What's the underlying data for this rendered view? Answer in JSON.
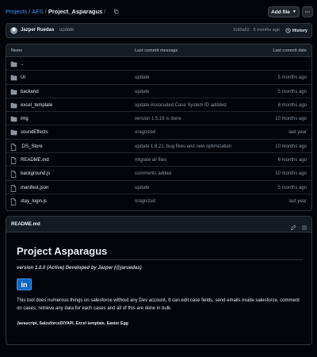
{
  "breadcrumb": {
    "parts": [
      "Projects",
      "AFS",
      "Project_Asparagus"
    ],
    "separator": "/"
  },
  "toolbar": {
    "add_file_label": "Add file",
    "more_label": "···"
  },
  "commit": {
    "author": "Jazper Ruedas",
    "message": "update",
    "meta": "1160a52 · 5 months ago",
    "history_label": "History"
  },
  "files": {
    "headers": {
      "name": "Name",
      "message": "Last commit message",
      "date": "Last commit date"
    },
    "rows": [
      {
        "name": "..",
        "message": "",
        "date": "",
        "icon": "folder-icon"
      },
      {
        "name": "UI",
        "message": "update",
        "date": "5 months ago",
        "icon": "folder-icon"
      },
      {
        "name": "backend",
        "message": "update",
        "date": "5 months ago",
        "icon": "folder-icon"
      },
      {
        "name": "excel_template",
        "message": "update Associated Case System ID addded",
        "date": "8 months ago",
        "icon": "folder-icon"
      },
      {
        "name": "img",
        "message": "version 1.5.16 is done",
        "date": "10 months ago",
        "icon": "folder-icon"
      },
      {
        "name": "soundEffects",
        "message": "oragnized",
        "date": "last year",
        "icon": "folder-icon"
      },
      {
        "name": ".DS_Store",
        "message": "update 1.8.21, bug fixes and new optimization",
        "date": "10 months ago",
        "icon": "file-icon"
      },
      {
        "name": "README.md",
        "message": "migrate all files",
        "date": "6 months ago",
        "icon": "file-icon"
      },
      {
        "name": "background.js",
        "message": "comments added",
        "date": "10 months ago",
        "icon": "file-icon"
      },
      {
        "name": "manifest.json",
        "message": "update",
        "date": "5 months ago",
        "icon": "file-icon"
      },
      {
        "name": "stay_login.js",
        "message": "oragnized",
        "date": "last year",
        "icon": "file-icon"
      }
    ]
  },
  "readme": {
    "tab_label": "README.md",
    "title": "Project Asparagus",
    "version_line": "version 1.0.0 (Active) Developed by Jazper (@jaruedas)",
    "logo_text": "in",
    "description": "This tool does numerous things on salesforce without any Dev account, It can edit case fields, send emails inside salesforce, comment on cases, retrieve any data for each cases and all of this are done in bulk.",
    "tags": "Javascript, SalesforceDIYAPI, Excel template, Easter Egg"
  },
  "colors": {
    "background": "#010409",
    "link": "#4493f8",
    "muted": "#8d96a0",
    "border": "#30363d"
  }
}
